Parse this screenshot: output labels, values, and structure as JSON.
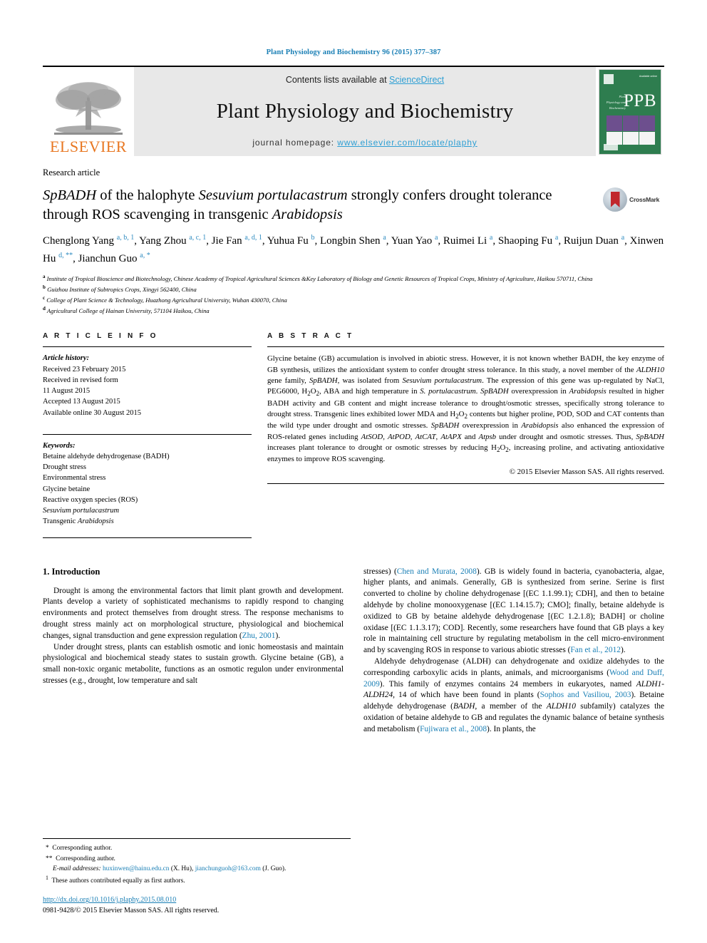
{
  "running_head": "Plant Physiology and Biochemistry 96 (2015) 377–387",
  "masthead": {
    "contents_prefix": "Contents lists available at ",
    "contents_link": "ScienceDirect",
    "journal_title": "Plant Physiology and Biochemistry",
    "homepage_prefix": "journal homepage: ",
    "homepage_url": "www.elsevier.com/locate/plaphy",
    "publisher": "ELSEVIER",
    "cover_abbrev": "PPB",
    "cover_side_words": "Plant Physiology and Biochemistry",
    "cover_corner_label": "Available online"
  },
  "article": {
    "type": "Research article",
    "title_part1": "SpBADH",
    "title_part2": " of the halophyte ",
    "title_part3": "Sesuvium portulacastrum",
    "title_part4": " strongly confers drought tolerance through ROS scavenging in transgenic ",
    "title_part5": "Arabidopsis",
    "crossmark_label": "CrossMark",
    "authors": "Chenglong Yang a, b, 1, Yang Zhou a, c, 1, Jie Fan a, d, 1, Yuhua Fu b, Longbin Shen a, Yuan Yao a, Ruimei Li a, Shaoping Fu a, Ruijun Duan a, Xinwen Hu d, **, Jianchun Guo a, *",
    "affiliations": [
      {
        "mark": "a",
        "text": "Institute of Tropical Bioscience and Biotechnology, Chinese Academy of Tropical Agricultural Sciences &Key Laboratory of Biology and Genetic Resources of Tropical Crops, Ministry of Agriculture, Haikou 570711, China"
      },
      {
        "mark": "b",
        "text": "Guizhou Institute of Subtropics Crops, Xingyi 562400, China"
      },
      {
        "mark": "c",
        "text": "College of Plant Science & Technology, Huazhong Agricultural University, Wuhan 430070, China"
      },
      {
        "mark": "d",
        "text": "Agricultural College of Hainan University, 571104 Haikou, China"
      }
    ]
  },
  "article_info": {
    "heading": "A R T I C L E  I N F O",
    "history_label": "Article history:",
    "history": [
      "Received 23 February 2015",
      "Received in revised form",
      "11 August 2015",
      "Accepted 13 August 2015",
      "Available online 30 August 2015"
    ],
    "keywords_label": "Keywords:",
    "keywords": [
      "Betaine aldehyde dehydrogenase (BADH)",
      "Drought stress",
      "Environmental stress",
      "Glycine betaine",
      "Reactive oxygen species (ROS)",
      "Sesuvium portulacastrum",
      "Transgenic Arabidopsis"
    ]
  },
  "abstract": {
    "heading": "A B S T R A C T",
    "text": "Glycine betaine (GB) accumulation is involved in abiotic stress. However, it is not known whether BADH, the key enzyme of GB synthesis, utilizes the antioxidant system to confer drought stress tolerance. In this study, a novel member of the ALDH10 gene family, SpBADH, was isolated from Sesuvium portulacastrum. The expression of this gene was up-regulated by NaCl, PEG6000, H2O2, ABA and high temperature in S. portulacastrum. SpBADH overexpression in Arabidopsis resulted in higher BADH activity and GB content and might increase tolerance to drought/osmotic stresses, specifically strong tolerance to drought stress. Transgenic lines exhibited lower MDA and H2O2 contents but higher proline, POD, SOD and CAT contents than the wild type under drought and osmotic stresses. SpBADH overexpression in Arabidopsis also enhanced the expression of ROS-related genes including AtSOD, AtPOD, AtCAT, AtAPX and Atpsb under drought and osmotic stresses. Thus, SpBADH increases plant tolerance to drought or osmotic stresses by reducing H2O2, increasing proline, and activating antioxidative enzymes to improve ROS scavenging.",
    "copyright": "© 2015 Elsevier Masson SAS. All rights reserved."
  },
  "introduction": {
    "heading": "1.  Introduction",
    "left_paragraphs": [
      "Drought is among the environmental factors that limit plant growth and development. Plants develop a variety of sophisticated mechanisms to rapidly respond to changing environments and protect themselves from drought stress. The response mechanisms to drought stress mainly act on morphological structure, physiological and biochemical changes, signal transduction and gene expression regulation (Zhu, 2001).",
      "Under drought stress, plants can establish osmotic and ionic homeostasis and maintain physiological and biochemical steady states to sustain growth. Glycine betaine (GB), a small non-toxic organic metabolite, functions as an osmotic regulon under environmental stresses (e.g., drought, low temperature and salt"
    ],
    "right_paragraphs": [
      "stresses) (Chen and Murata, 2008). GB is widely found in bacteria, cyanobacteria, algae, higher plants, and animals. Generally, GB is synthesized from serine. Serine is first converted to choline by choline dehydrogenase [(EC 1.1.99.1); CDH], and then to betaine aldehyde by choline monooxygenase [(EC 1.14.15.7); CMO]; finally, betaine aldehyde is oxidized to GB by betaine aldehyde dehydrogenase [(EC 1.2.1.8); BADH] or choline oxidase [(EC 1.1.3.17); COD]. Recently, some researchers have found that GB plays a key role in maintaining cell structure by regulating metabolism in the cell micro-environment and by scavenging ROS in response to various abiotic stresses (Fan et al., 2012).",
      "Aldehyde dehydrogenase (ALDH) can dehydrogenate and oxidize aldehydes to the corresponding carboxylic acids in plants, animals, and microorganisms (Wood and Duff, 2009). This family of enzymes contains 24 members in eukaryotes, named ALDH1-ALDH24, 14 of which have been found in plants (Sophos and Vasiliou, 2003). Betaine aldehyde dehydrogenase (BADH, a member of the ALDH10 subfamily) catalyzes the oxidation of betaine aldehyde to GB and regulates the dynamic balance of betaine synthesis and metabolism (Fujiwara et al., 2008). In plants, the"
    ]
  },
  "footnotes": {
    "star1": "Corresponding author.",
    "star2": "Corresponding author.",
    "email_label": "E-mail addresses:",
    "email1": "huxinwen@hainu.edu.cn",
    "email1_who": "(X. Hu)",
    "email2": "jianchunguoh@163.com",
    "email2_who": "(J. Guo).",
    "equal_contrib": "These authors contributed equally as first authors.",
    "doi": "http://dx.doi.org/10.1016/j.plaphy.2015.08.010",
    "issn_line": "0981-9428/© 2015 Elsevier Masson SAS. All rights reserved."
  },
  "colors": {
    "link": "#1a7fb5",
    "sciencedirect": "#2e9fd4",
    "elsevier_orange": "#E87722",
    "cover_green": "#2e7d4f"
  }
}
